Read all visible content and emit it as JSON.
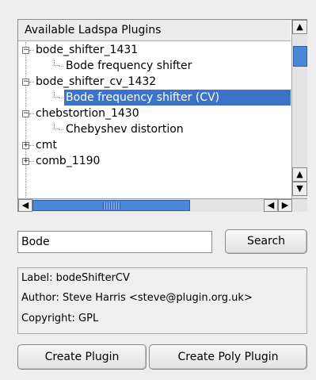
{
  "plugin_tree": {
    "header": "Available Ladspa Plugins",
    "rows": [
      {
        "label": "bode_shifter_1431",
        "level": 0,
        "expanded": true
      },
      {
        "label": "Bode frequency shifter",
        "level": 1
      },
      {
        "label": "bode_shifter_cv_1432",
        "level": 0,
        "expanded": true
      },
      {
        "label": "Bode frequency shifter (CV)",
        "level": 1,
        "selected": true
      },
      {
        "label": "chebstortion_1430",
        "level": 0,
        "expanded": true
      },
      {
        "label": "Chebyshev distortion",
        "level": 1
      },
      {
        "label": "cmt",
        "level": 0,
        "expanded": false
      },
      {
        "label": "comb_1190",
        "level": 0,
        "expanded": false
      }
    ]
  },
  "search": {
    "value": "Bode",
    "button_label": "Search"
  },
  "info": {
    "label_line": "Label: bodeShifterCV",
    "author_line": "Author: Steve Harris <steve@plugin.org.uk>",
    "copyright_line": "Copyright: GPL"
  },
  "actions": {
    "create_plugin": "Create Plugin",
    "create_poly_plugin": "Create Poly Plugin"
  },
  "colors": {
    "selection": "#3c72c8",
    "scroll_thumb": "#4b87d8",
    "background": "#eeeeee"
  },
  "icons": {
    "expand_open": "minus-box",
    "expand_closed": "plus-box",
    "scroll_up": "arrow-up",
    "scroll_down": "arrow-down",
    "scroll_left": "arrow-left",
    "scroll_right": "arrow-right"
  }
}
